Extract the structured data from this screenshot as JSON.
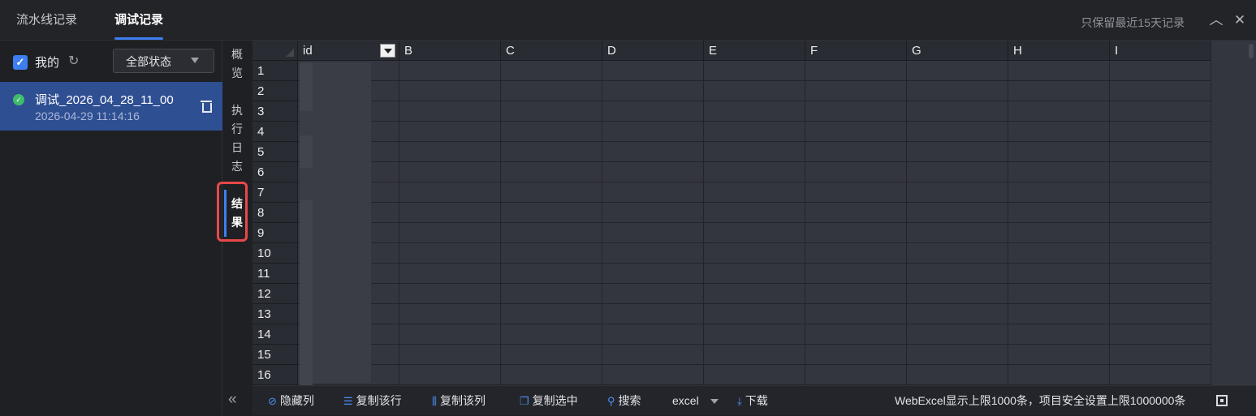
{
  "header": {
    "tabs": [
      {
        "label": "流水线记录",
        "active": false
      },
      {
        "label": "调试记录",
        "active": true
      }
    ],
    "retention_text": "只保留最近15天记录",
    "collapse_icon": "chevron-up-icon",
    "close_icon": "close-icon"
  },
  "filter": {
    "mine_label": "我的",
    "mine_checked": true,
    "status_select": "全部状态"
  },
  "records": [
    {
      "name": "调试_2026_04_28_11_00",
      "time": "2026-04-29 11:14:16",
      "status": "success"
    }
  ],
  "side_tabs": [
    {
      "label": "概览",
      "active": false
    },
    {
      "label": "执行日志",
      "active": false
    },
    {
      "label": "结果",
      "active": true
    }
  ],
  "grid": {
    "columns": [
      "id",
      "B",
      "C",
      "D",
      "E",
      "F",
      "G",
      "H",
      "I"
    ],
    "rows": [
      "1",
      "2",
      "3",
      "4",
      "5",
      "6",
      "7",
      "8",
      "9",
      "10",
      "11",
      "12",
      "13",
      "14",
      "15",
      "16"
    ]
  },
  "toolbar": {
    "hide_col": "隐藏列",
    "copy_row": "复制该行",
    "copy_col": "复制该列",
    "copy_sel": "复制选中",
    "search": "搜索",
    "format": "excel",
    "download": "下载",
    "limit_text": "WebExcel显示上限1000条，项目安全设置上限1000000条"
  },
  "colors": {
    "accent": "#3f7ef0",
    "selected_record": "#2f4f93",
    "success": "#3fbd6b",
    "highlight_box": "#e84848"
  }
}
